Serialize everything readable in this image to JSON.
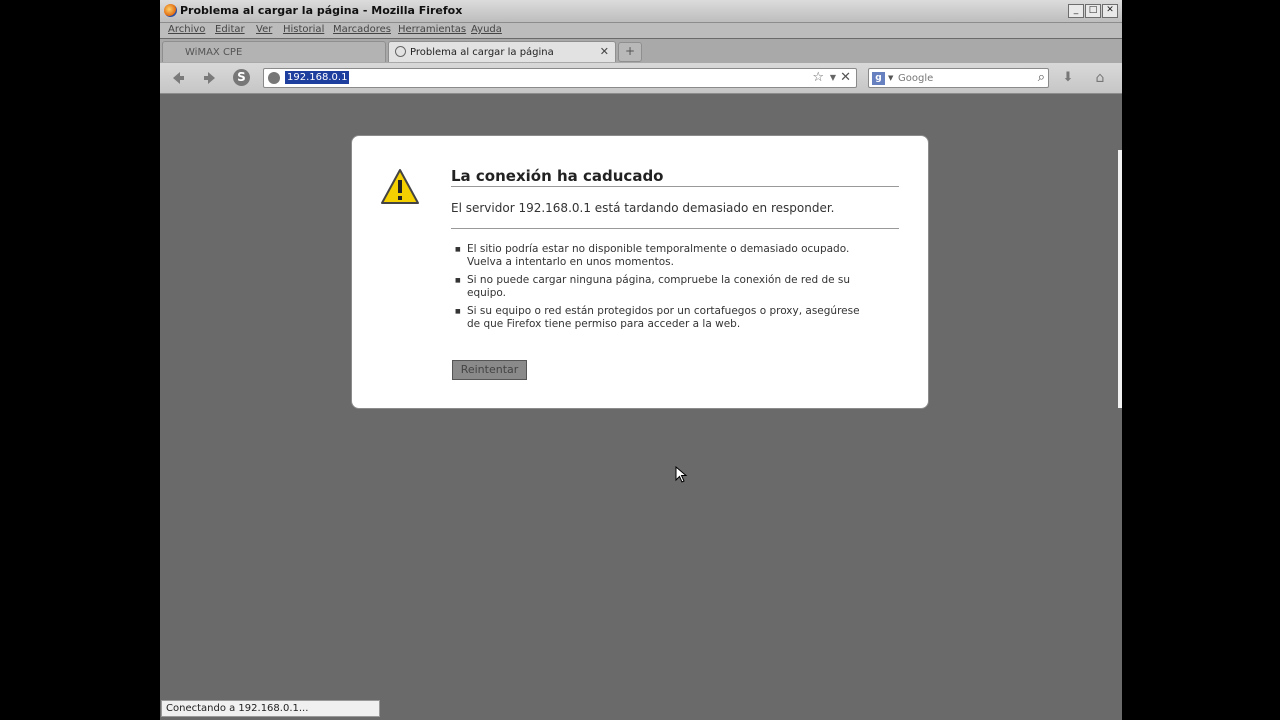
{
  "window": {
    "title": "Problema al cargar la página - Mozilla Firefox",
    "controls": {
      "minimize": "_",
      "maximize": "□",
      "close": "✕"
    }
  },
  "menu": {
    "items": [
      {
        "label": "Archivo"
      },
      {
        "label": "Editar"
      },
      {
        "label": "Ver"
      },
      {
        "label": "Historial"
      },
      {
        "label": "Marcadores"
      },
      {
        "label": "Herramientas"
      },
      {
        "label": "Ayuda"
      }
    ]
  },
  "tabs": [
    {
      "label": "WiMAX CPE",
      "active": false
    },
    {
      "label": "Problema al cargar la página",
      "active": true,
      "close": "✕"
    }
  ],
  "newtab_symbol": "+",
  "nav": {
    "back_icon": "arrow-left-icon",
    "forward_icon": "arrow-right-icon",
    "addon_symbol": "S",
    "url": "192.168.0.1",
    "bookmark_symbol": "☆",
    "dropdown_symbol": "▼",
    "stop_symbol": "✕",
    "search_engine_symbol": "g",
    "search_placeholder": "Google",
    "search_symbol": "⌕",
    "download_symbol": "⬇",
    "home_symbol": "⌂"
  },
  "error": {
    "title": "La conexión ha caducado",
    "description": "El servidor 192.168.0.1 está tardando demasiado en responder.",
    "tips": [
      "El sitio podría estar no disponible temporalmente o demasiado ocupado. Vuelva a intentarlo en unos momentos.",
      "Si no puede cargar ninguna página, compruebe la conexión de red de su equipo.",
      "Si su equipo o red están protegidos por un cortafuegos o proxy, asegúrese de que Firefox tiene permiso para acceder a la web."
    ],
    "retry_label": "Reintentar"
  },
  "status": {
    "text": "Conectando a 192.168.0.1..."
  },
  "colors": {
    "content_bg": "#6a6a6a",
    "url_highlight": "#1f3f9f",
    "warning_yellow": "#f5d000"
  }
}
